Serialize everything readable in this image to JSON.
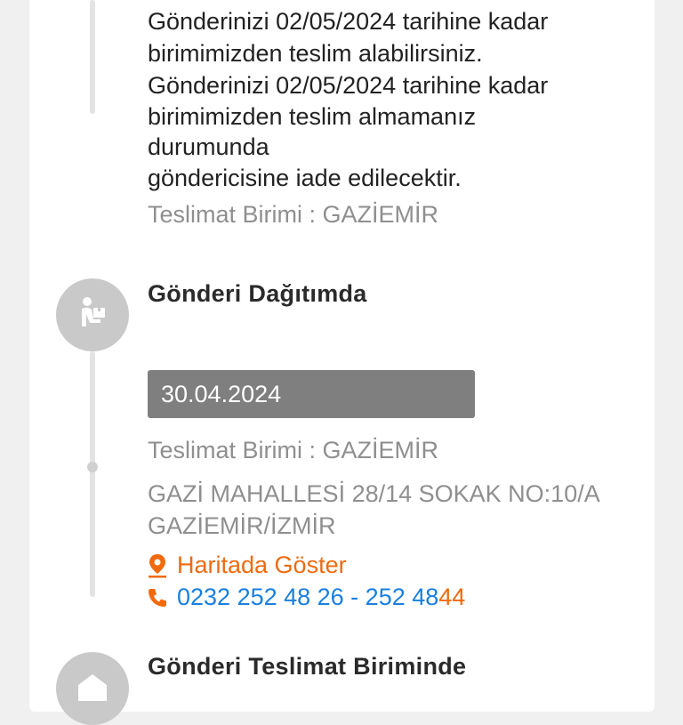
{
  "top_section": {
    "message_lines": [
      "Gönderinizi 02/05/2024 tarihine kadar",
      "birimimizden teslim alabilirsiniz.",
      "Gönderinizi 02/05/2024 tarihine kadar",
      "birimimizden teslim almamanız",
      "durumunda",
      "göndericisine iade edilecektir."
    ],
    "unit_label": "Teslimat Birimi : GAZİEMİR"
  },
  "dispatch_section": {
    "title": "Gönderi Dağıtımda",
    "date": "30.04.2024",
    "unit_label": "Teslimat Birimi : GAZİEMİR",
    "address_line1": "GAZİ MAHALLESİ 28/14 SOKAK NO:10/A",
    "address_line2": "GAZİEMİR/İZMİR",
    "map_link": "Haritada Göster",
    "phone_main": "0232 252 48 26 - 252 48 ",
    "phone_ext": "44"
  },
  "next_section": {
    "title": "Gönderi Teslimat Biriminde"
  },
  "icons": {
    "dispatch": "courier-icon",
    "map": "map-pin-icon",
    "phone": "phone-icon",
    "unit": "building-icon"
  },
  "colors": {
    "accent": "#f06a0f",
    "link": "#1a7fe0",
    "date_box": "#7f7f7f",
    "icon_circle": "#c9c9c9"
  }
}
